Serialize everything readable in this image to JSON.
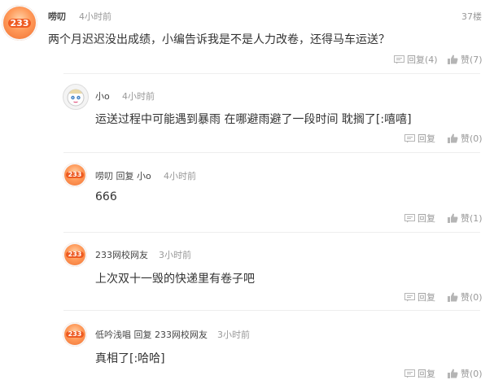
{
  "comment_main": {
    "username": "唠叨",
    "time": "4小时前",
    "floor": "37楼",
    "text": "两个月迟迟没出成绩，小编告诉我是不是人力改卷，还得马车运送？",
    "reply_label": "回复(4)",
    "like_label": "赞(7)",
    "avatar_text": "233"
  },
  "replies": [
    {
      "username": "小o",
      "time": "4小时前",
      "text": "运送过程中可能遇到暴雨 在哪避雨避了一段时间 耽搁了[:嘻嘻]",
      "reply_label": "回复",
      "like_label": "赞(0)"
    },
    {
      "username": "唠叨 回复 小o",
      "time": "4小时前",
      "text": "666",
      "reply_label": "回复",
      "like_label": "赞(1)",
      "avatar_text": "233"
    },
    {
      "username": "233网校网友",
      "time": "3小时前",
      "text": "上次双十一毁的快递里有卷子吧",
      "reply_label": "回复",
      "like_label": "赞(0)",
      "avatar_text": "233"
    },
    {
      "username": "低吟浅唱 回复 233网校网友",
      "time": "3小时前",
      "text": "真相了[:哈哈]",
      "reply_label": "回复",
      "like_label": "赞(0)",
      "avatar_text": "233"
    }
  ],
  "icons": {
    "reply": "reply-icon",
    "like": "thumbs-up-icon"
  },
  "colors": {
    "avatar_orange": "#ef6a2a",
    "muted_text": "#999999"
  }
}
